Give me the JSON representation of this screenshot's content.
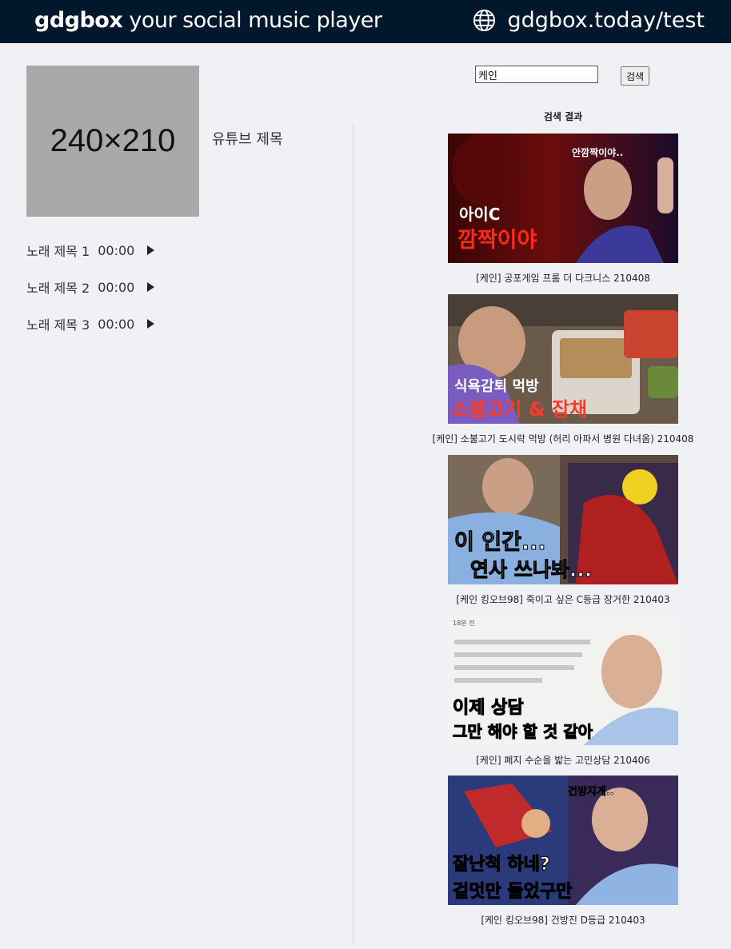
{
  "header": {
    "brand_bold": "gdgbox",
    "brand_rest": " your social music player",
    "site_url": "gdgbox.today/test",
    "site_icon": "globe-icon"
  },
  "player": {
    "thumbnail_text": "240×210",
    "youtube_title": "유튜브 제목",
    "songs": [
      {
        "title": "노래 제목 1",
        "time": "00:00"
      },
      {
        "title": "노래 제목 2",
        "time": "00:00"
      },
      {
        "title": "노래 제목 3",
        "time": "00:00"
      }
    ]
  },
  "search": {
    "value": "케인",
    "button_label": "검색",
    "results_label": "검색 결과"
  },
  "results": [
    {
      "caption": "[케인] 공포게임 프롬 더 다크니스 210408",
      "overlay_top": "안깜짝이야..",
      "overlay_line1": "아이C",
      "overlay_line2": "깜짝이야"
    },
    {
      "caption": "[케인] 소불고기 도시락 먹방 (허리 아파서 병원 다녀옴) 210408",
      "overlay_line1": "식욕감퇴 먹방",
      "overlay_line2": "소불고기 & 잡채"
    },
    {
      "caption": "[케인 킹오브98] 죽이고 싶은 C등급 장거한 210403",
      "overlay_line1": "이 인간...",
      "overlay_line2": "연사 쓰나봐..."
    },
    {
      "caption": "[케인] 폐지 수순을 밟는 고민상담 210406",
      "overlay_top": "18분 전",
      "overlay_line1": "이제 상담",
      "overlay_line2": "그만 해야 할 것 같아"
    },
    {
      "caption": "[케인 킹오브98] 건방진 D등급 210403",
      "overlay_top": "건방지게..",
      "overlay_line1": "잘난척 하네?",
      "overlay_line2": "겉멋만 들었구만"
    }
  ]
}
